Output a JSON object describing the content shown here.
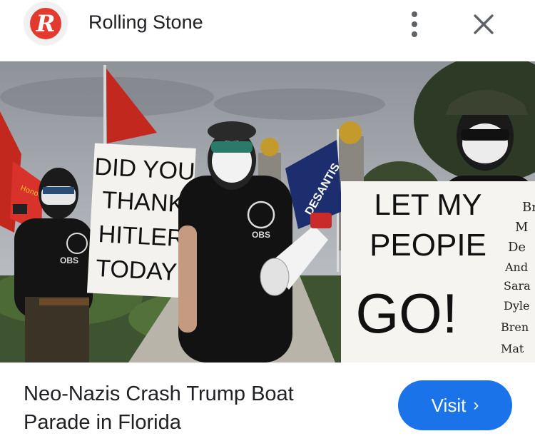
{
  "header": {
    "logo_letter": "R",
    "source_name": "Rolling Stone",
    "more_icon": "more-vert-icon",
    "close_icon": "close-icon"
  },
  "image": {
    "signs": {
      "left": [
        "DID YOU",
        "THANK",
        "HITLER",
        "TODAY?"
      ],
      "right": [
        "LET MY",
        "PEOPIE",
        "GO!"
      ],
      "right_names": [
        "Br",
        "M",
        "De",
        "And",
        "Sara",
        "Dyle",
        "Bren",
        "Mat"
      ]
    },
    "shirt_text": "OBS",
    "flag_text": "DESANTIS",
    "small_flag_text": "Honor"
  },
  "result": {
    "title": "Neo-Nazis Crash Trump Boat Parade in Florida",
    "visit_label": "Visit",
    "visit_chevron": "›"
  },
  "colors": {
    "brand_red": "#e23a2e",
    "visit_blue": "#1a73e8",
    "text": "#202124"
  }
}
